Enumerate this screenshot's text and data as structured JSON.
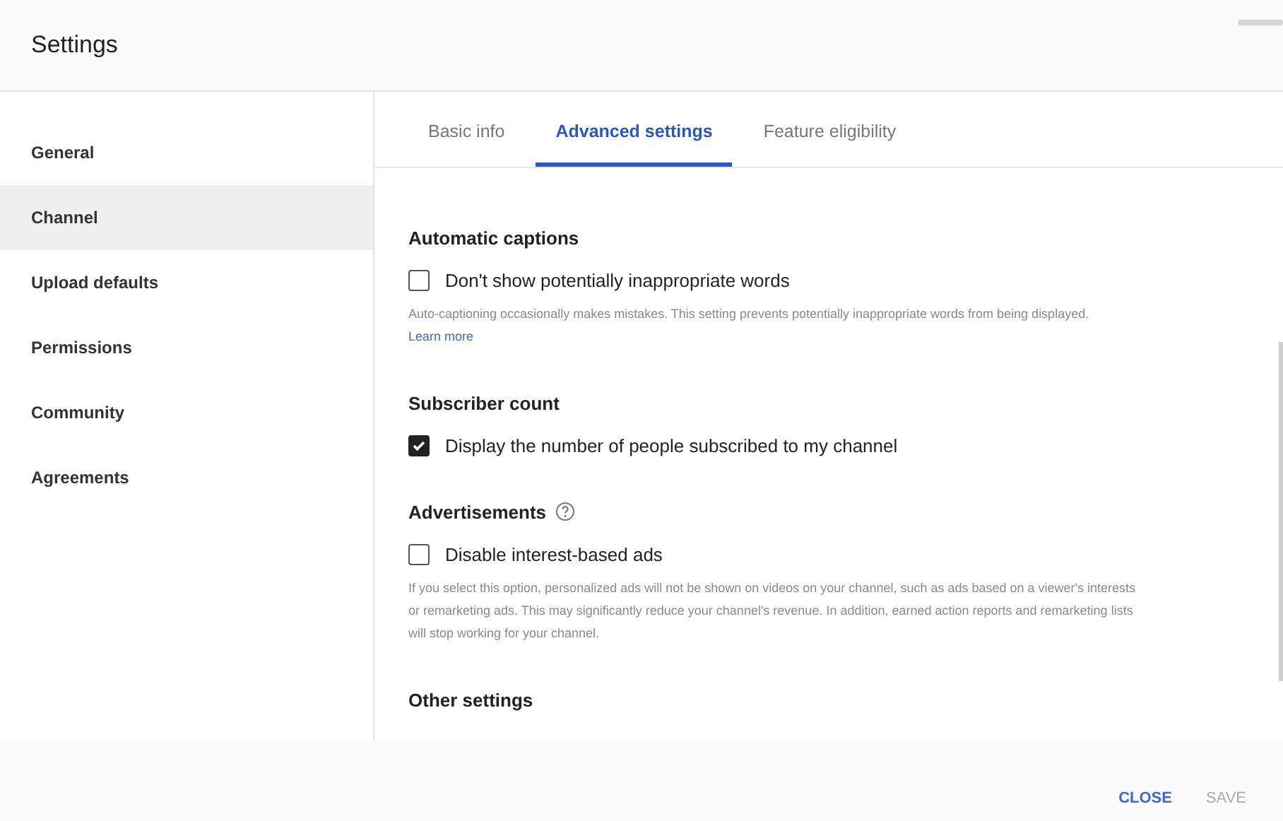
{
  "window": {
    "title": "Settings"
  },
  "sidebar": {
    "items": [
      {
        "label": "General",
        "selected": false
      },
      {
        "label": "Channel",
        "selected": true
      },
      {
        "label": "Upload defaults",
        "selected": false
      },
      {
        "label": "Permissions",
        "selected": false
      },
      {
        "label": "Community",
        "selected": false
      },
      {
        "label": "Agreements",
        "selected": false
      }
    ]
  },
  "tabs": [
    {
      "label": "Basic info",
      "selected": false
    },
    {
      "label": "Advanced settings",
      "selected": true
    },
    {
      "label": "Feature eligibility",
      "selected": false
    }
  ],
  "sections": [
    {
      "title": "Automatic captions",
      "help": false,
      "option": {
        "label": "Don't show potentially inappropriate words",
        "checked": false
      },
      "description": "Auto-captioning occasionally makes mistakes. This setting prevents potentially inappropriate words from being displayed.",
      "link": "Learn more"
    },
    {
      "title": "Subscriber count",
      "help": false,
      "option": {
        "label": "Display the number of people subscribed to my channel",
        "checked": true
      }
    },
    {
      "title": "Advertisements",
      "help": true,
      "option": {
        "label": "Disable interest-based ads",
        "checked": false
      },
      "description": "If you select this option, personalized ads will not be shown on videos on your channel, such as ads based on a viewer's interests or remarketing ads. This may significantly reduce your channel's revenue. In addition, earned action reports and remarketing lists will stop working for your channel."
    },
    {
      "title": "Other settings",
      "help": false
    }
  ],
  "buttons": [
    {
      "label": "CLOSE",
      "disabled": false
    },
    {
      "label": "SAVE",
      "disabled": true
    }
  ]
}
